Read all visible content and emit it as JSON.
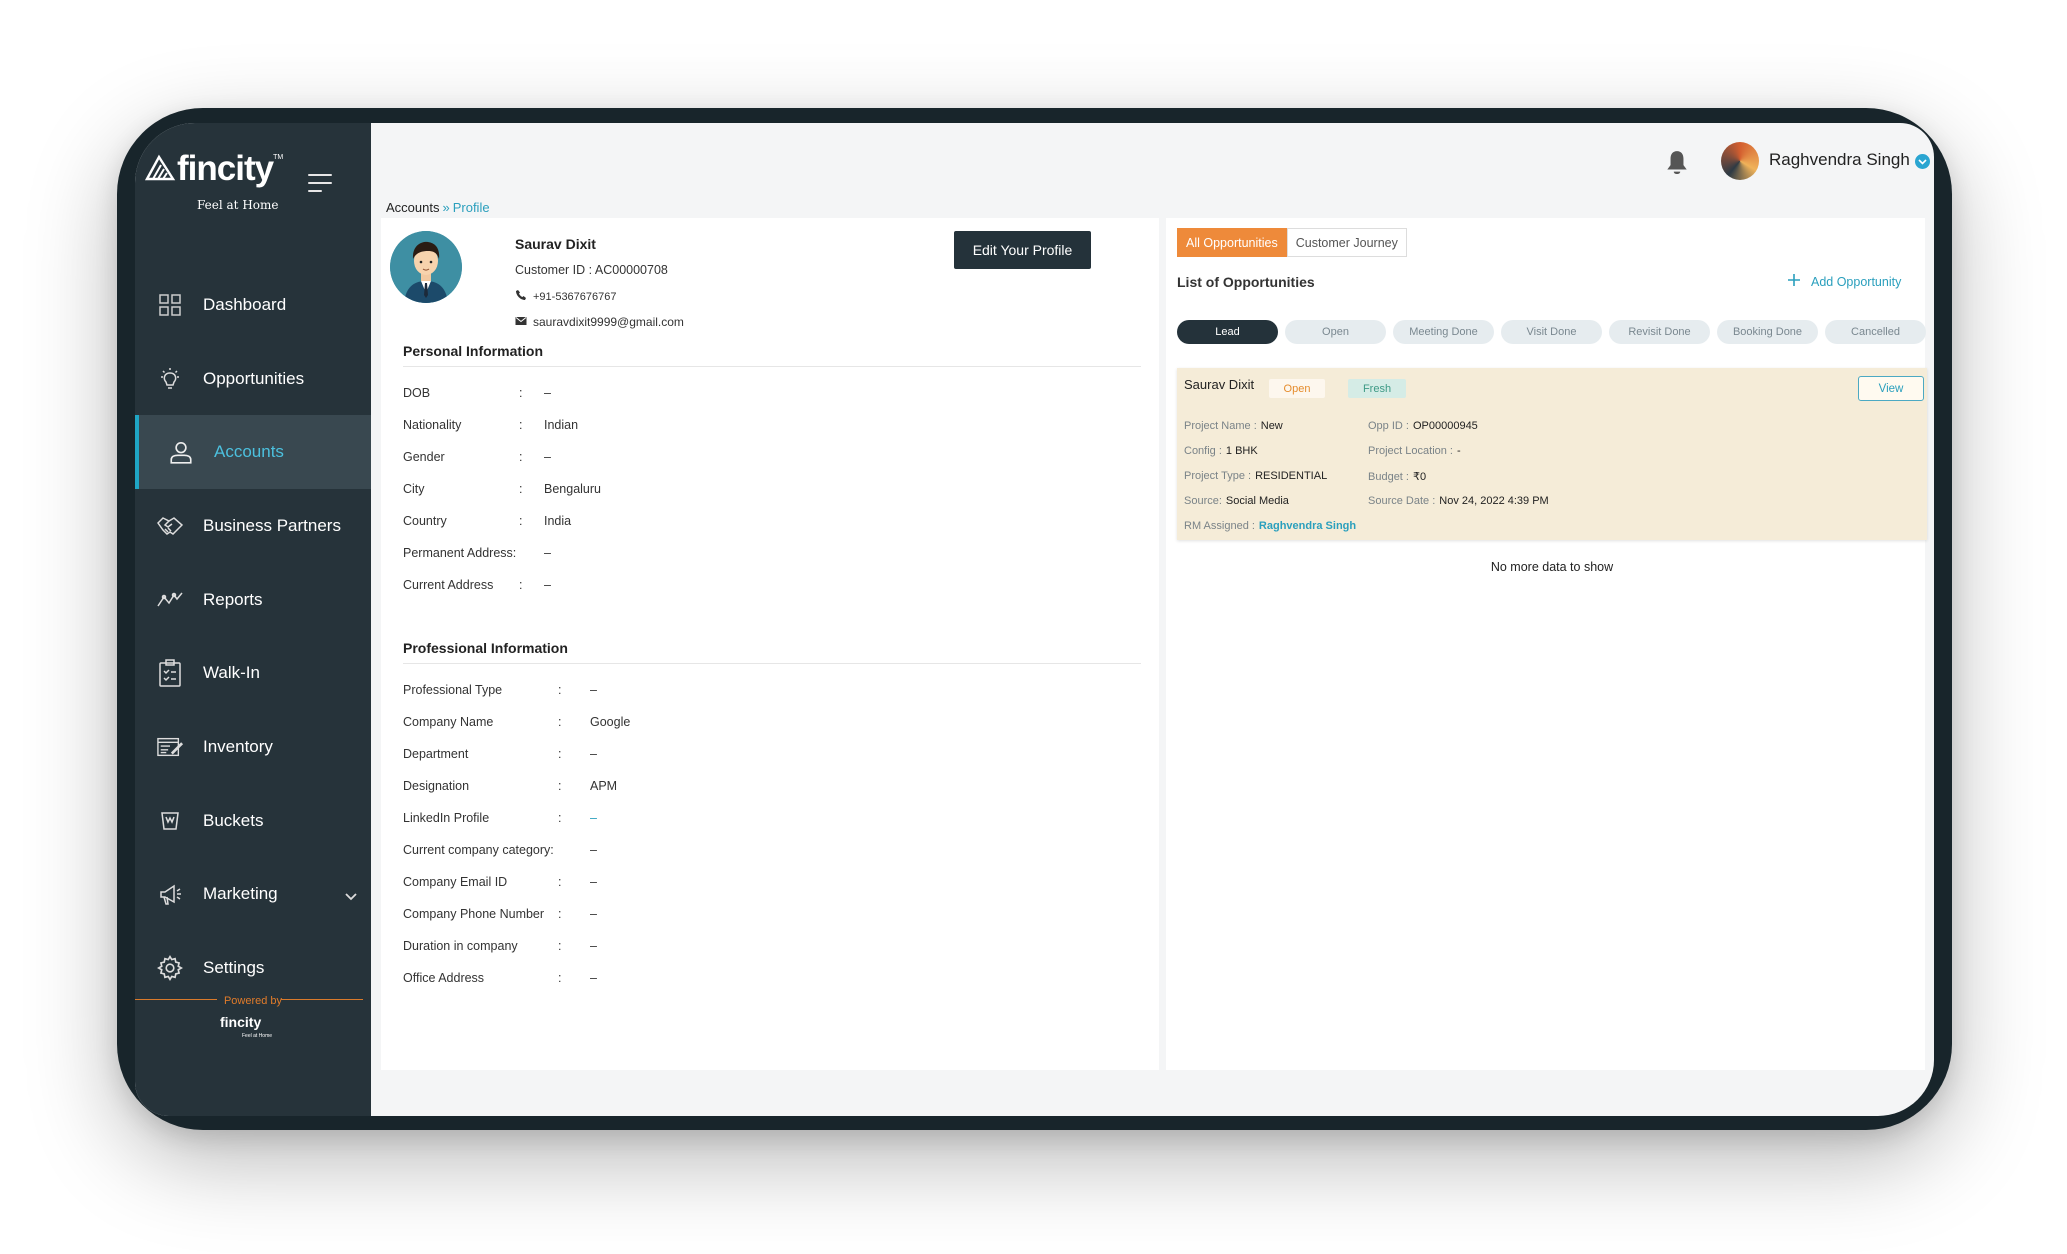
{
  "brand": {
    "logo_text": "fincity",
    "trademark": "TM",
    "tagline": "Feel at Home",
    "powered_by": "Powered by",
    "powered_logo": "fincity",
    "powered_tagline": "Feel at Home"
  },
  "sidebar": {
    "items": [
      {
        "label": "Dashboard",
        "icon": "dashboard-icon"
      },
      {
        "label": "Opportunities",
        "icon": "lightbulb-icon"
      },
      {
        "label": "Accounts",
        "icon": "user-icon",
        "active": true
      },
      {
        "label": "Business Partners",
        "icon": "handshake-icon"
      },
      {
        "label": "Reports",
        "icon": "trend-line-icon"
      },
      {
        "label": "Walk-In",
        "icon": "clipboard-icon"
      },
      {
        "label": "Inventory",
        "icon": "inventory-icon"
      },
      {
        "label": "Buckets",
        "icon": "bucket-icon"
      },
      {
        "label": "Marketing",
        "icon": "megaphone-icon",
        "expandable": true
      },
      {
        "label": "Settings",
        "icon": "gear-icon"
      }
    ]
  },
  "header": {
    "user_name": "Raghvendra Singh"
  },
  "breadcrumb": {
    "parent": "Accounts",
    "separator": "»",
    "current": "Profile"
  },
  "profile": {
    "name": "Saurav Dixit",
    "customer_id": "Customer ID : AC00000708",
    "phone": "+91-5367676767",
    "email": "sauravdixit9999@gmail.com",
    "edit_label": "Edit Your Profile"
  },
  "personal": {
    "title": "Personal Information",
    "fields": [
      {
        "label": "DOB",
        "sep": ":",
        "value": "–"
      },
      {
        "label": "Nationality",
        "sep": ":",
        "value": "Indian"
      },
      {
        "label": "Gender",
        "sep": ":",
        "value": "–"
      },
      {
        "label": "City",
        "sep": ":",
        "value": "Bengaluru"
      },
      {
        "label": "Country",
        "sep": ":",
        "value": "India"
      },
      {
        "label": "Permanent Address:",
        "sep": "",
        "value": "–"
      },
      {
        "label": "Current Address",
        "sep": ":",
        "value": "–"
      }
    ]
  },
  "professional": {
    "title": "Professional Information",
    "fields": [
      {
        "label": "Professional Type",
        "sep": ":",
        "value": "–"
      },
      {
        "label": "Company Name",
        "sep": ":",
        "value": "Google"
      },
      {
        "label": "Department",
        "sep": ":",
        "value": "–"
      },
      {
        "label": "Designation",
        "sep": ":",
        "value": "APM"
      },
      {
        "label": "LinkedIn Profile",
        "sep": ":",
        "value": "–"
      },
      {
        "label": "Current company category:",
        "sep": "",
        "value": "–"
      },
      {
        "label": "Company Email ID",
        "sep": ":",
        "value": "–"
      },
      {
        "label": "Company Phone Number",
        "sep": ":",
        "value": "–"
      },
      {
        "label": "Duration in company",
        "sep": ":",
        "value": "–"
      },
      {
        "label": "Office Address",
        "sep": ":",
        "value": "–"
      }
    ]
  },
  "opportunities": {
    "tabs": [
      "All Opportunities",
      "Customer Journey"
    ],
    "active_tab": "All Opportunities",
    "list_title": "List of Opportunities",
    "add_label": "Add Opportunity",
    "stages": [
      "Lead",
      "Open",
      "Meeting Done",
      "Visit Done",
      "Revisit Done",
      "Booking Done",
      "Cancelled"
    ],
    "active_stage": "Lead",
    "card": {
      "name": "Saurav Dixit",
      "status": "Open",
      "tag": "Fresh",
      "view_label": "View",
      "project_name_label": "Project Name :",
      "project_name": "New",
      "opp_id_label": "Opp ID :",
      "opp_id": "OP00000945",
      "config_label": "Config :",
      "config": "1 BHK",
      "project_location_label": "Project Location :",
      "project_location": "-",
      "project_type_label": "Project Type :",
      "project_type": "RESIDENTIAL",
      "budget_label": "Budget :",
      "budget": "₹0",
      "source_label": "Source:",
      "source": "Social Media",
      "source_date_label": "Source Date :",
      "source_date": "Nov 24, 2022 4:39 PM",
      "rm_label": "RM Assigned :",
      "rm": "Raghvendra Singh"
    },
    "empty_text": "No more data to show"
  },
  "colors": {
    "sidebar": "#26333a",
    "accent": "#ee8a3a",
    "link": "#2a9fbd",
    "card_bg": "#f5ecd8"
  }
}
